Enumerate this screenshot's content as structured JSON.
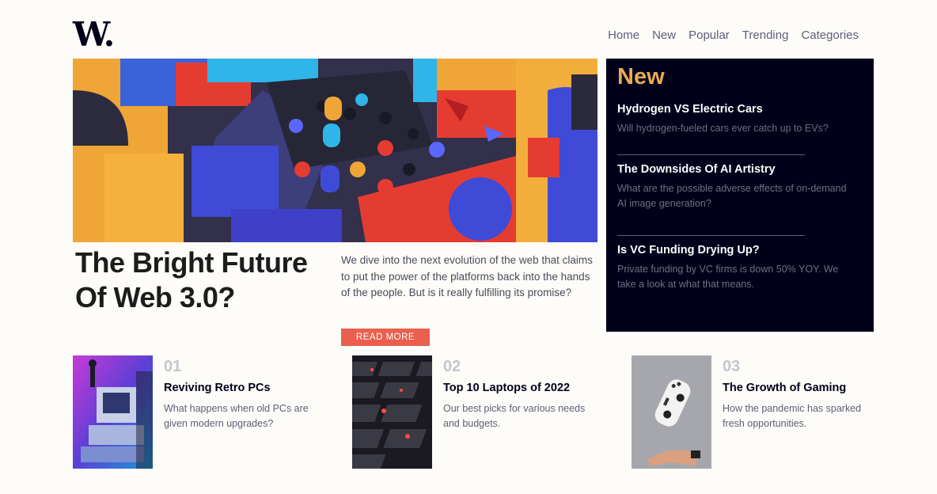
{
  "logo": "W.",
  "nav": {
    "items": [
      "Home",
      "New",
      "Popular",
      "Trending",
      "Categories"
    ]
  },
  "hero": {
    "title": "The Bright Future Of Web 3.0?",
    "description": "We dive into the next evolution of the web that claims to put the power of the platforms back into the hands of the people. But is it really fulfilling its promise?",
    "button_label": "READ MORE"
  },
  "new_panel": {
    "heading": "New",
    "items": [
      {
        "title": "Hydrogen VS Electric Cars",
        "desc": "Will hydrogen-fueled cars ever catch up to EVs?"
      },
      {
        "title": "The Downsides Of AI Artistry",
        "desc": "What are the possible adverse effects of on-demand AI image generation?"
      },
      {
        "title": "Is VC Funding Drying Up?",
        "desc": "Private funding by VC firms is down 50% YOY. We take a look at what that means."
      }
    ]
  },
  "cards": [
    {
      "number": "01",
      "title": "Reviving Retro PCs",
      "desc": "What happens when old PCs are given modern upgrades?"
    },
    {
      "number": "02",
      "title": "Top 10 Laptops of 2022",
      "desc": "Our best picks for various needs and budgets."
    },
    {
      "number": "03",
      "title": "The Growth of Gaming",
      "desc": "How the pandemic has sparked fresh opportunities."
    }
  ],
  "colors": {
    "background": "#fdfcf8",
    "dark_blue": "#00001a",
    "soft_orange": "#e9ab53",
    "soft_red": "#ea5f4e",
    "grayish_blue": "#5d5f79"
  }
}
